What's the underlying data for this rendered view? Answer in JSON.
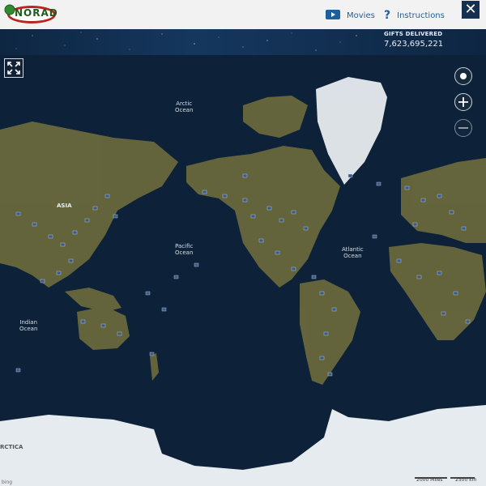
{
  "header": {
    "logo_text": "NORAD",
    "movies_label": "Movies",
    "instructions_label": "Instructions",
    "close_label": "✕"
  },
  "gifts": {
    "label": "GIFTS DELIVERED",
    "count": "7,623,695,221"
  },
  "map": {
    "labels": {
      "arctic_ocean": "Arctic\nOcean",
      "pacific_ocean": "Pacific\nOcean",
      "atlantic_ocean": "Atlantic\nOcean",
      "indian_ocean": "Indian\nOcean",
      "asia": "ASIA",
      "antarctica_partial": "RCTICA"
    },
    "scale": {
      "miles": "2000 Miles",
      "km": "2500 km"
    },
    "legal": "bing"
  },
  "colors": {
    "ocean": "#0d2238",
    "land": "#6b6a3f",
    "ice": "#e9eef3",
    "marker": "#3b5780"
  }
}
